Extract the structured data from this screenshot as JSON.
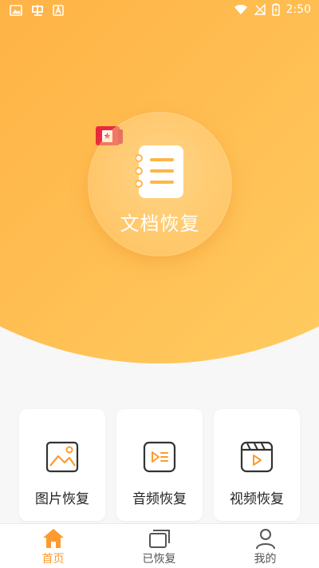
{
  "status_bar": {
    "time": "2:50"
  },
  "hero": {
    "doc_recovery_label": "文档恢复"
  },
  "cards": [
    {
      "label": "图片恢复",
      "icon": "image-icon"
    },
    {
      "label": "音频恢复",
      "icon": "audio-icon"
    },
    {
      "label": "视频恢复",
      "icon": "video-icon"
    }
  ],
  "nav": [
    {
      "label": "首页",
      "icon": "home-icon",
      "active": true
    },
    {
      "label": "已恢复",
      "icon": "recovered-icon",
      "active": false
    },
    {
      "label": "我的",
      "icon": "user-icon",
      "active": false
    }
  ],
  "colors": {
    "accent": "#ff9a2e",
    "badge": "#e8283c"
  }
}
